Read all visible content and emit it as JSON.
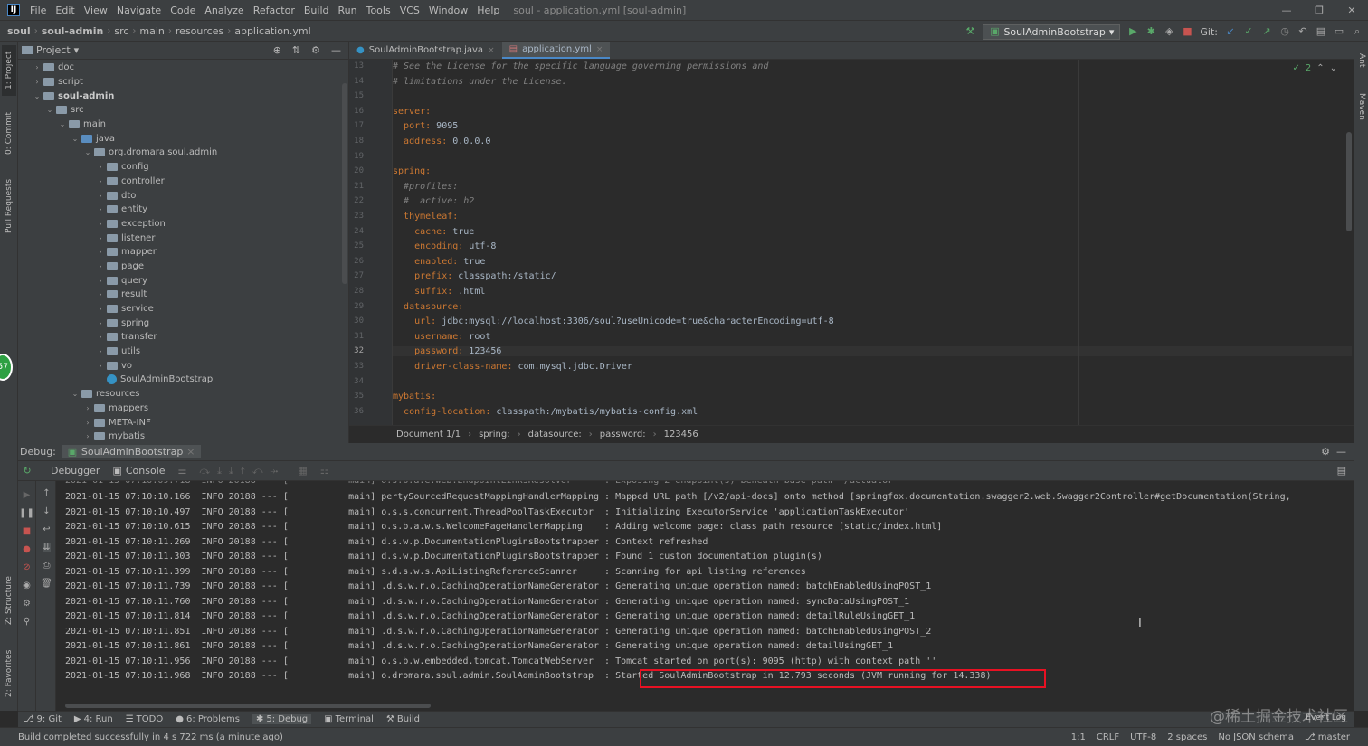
{
  "app": {
    "logo": "IJ",
    "menu": [
      "File",
      "Edit",
      "View",
      "Navigate",
      "Code",
      "Analyze",
      "Refactor",
      "Build",
      "Run",
      "Tools",
      "VCS",
      "Window",
      "Help"
    ],
    "title": "soul - application.yml [soul-admin]"
  },
  "navbar": {
    "crumbs": [
      "soul",
      "soul-admin",
      "src",
      "main",
      "resources",
      "application.yml"
    ],
    "run_config": "SoulAdminBootstrap",
    "git_label": "Git:"
  },
  "left_stripe": {
    "project": "1: Project",
    "commit": "0: Commit",
    "pull": "Pull Requests",
    "structure": "Z: Structure",
    "favorites": "2: Favorites"
  },
  "right_stripe": {
    "ant": "Ant",
    "maven": "Maven"
  },
  "project_panel": {
    "title": "Project",
    "tree": [
      {
        "label": "doc",
        "depth": 1,
        "kind": "folder",
        "open": false
      },
      {
        "label": "script",
        "depth": 1,
        "kind": "folder",
        "open": false
      },
      {
        "label": "soul-admin",
        "depth": 1,
        "kind": "folder",
        "open": true,
        "bold": true
      },
      {
        "label": "src",
        "depth": 2,
        "kind": "folder",
        "open": true
      },
      {
        "label": "main",
        "depth": 3,
        "kind": "folder",
        "open": true
      },
      {
        "label": "java",
        "depth": 4,
        "kind": "folder-blue",
        "open": true
      },
      {
        "label": "org.dromara.soul.admin",
        "depth": 5,
        "kind": "folder",
        "open": true
      },
      {
        "label": "config",
        "depth": 6,
        "kind": "folder",
        "open": false
      },
      {
        "label": "controller",
        "depth": 6,
        "kind": "folder",
        "open": false
      },
      {
        "label": "dto",
        "depth": 6,
        "kind": "folder",
        "open": false
      },
      {
        "label": "entity",
        "depth": 6,
        "kind": "folder",
        "open": false
      },
      {
        "label": "exception",
        "depth": 6,
        "kind": "folder",
        "open": false
      },
      {
        "label": "listener",
        "depth": 6,
        "kind": "folder",
        "open": false
      },
      {
        "label": "mapper",
        "depth": 6,
        "kind": "folder",
        "open": false
      },
      {
        "label": "page",
        "depth": 6,
        "kind": "folder",
        "open": false
      },
      {
        "label": "query",
        "depth": 6,
        "kind": "folder",
        "open": false
      },
      {
        "label": "result",
        "depth": 6,
        "kind": "folder",
        "open": false
      },
      {
        "label": "service",
        "depth": 6,
        "kind": "folder",
        "open": false
      },
      {
        "label": "spring",
        "depth": 6,
        "kind": "folder",
        "open": false
      },
      {
        "label": "transfer",
        "depth": 6,
        "kind": "folder",
        "open": false
      },
      {
        "label": "utils",
        "depth": 6,
        "kind": "folder",
        "open": false
      },
      {
        "label": "vo",
        "depth": 6,
        "kind": "folder",
        "open": false
      },
      {
        "label": "SoulAdminBootstrap",
        "depth": 6,
        "kind": "class",
        "leaf": true
      },
      {
        "label": "resources",
        "depth": 4,
        "kind": "folder",
        "open": true
      },
      {
        "label": "mappers",
        "depth": 5,
        "kind": "folder",
        "open": false
      },
      {
        "label": "META-INF",
        "depth": 5,
        "kind": "folder",
        "open": false
      },
      {
        "label": "mybatis",
        "depth": 5,
        "kind": "folder",
        "open": false
      }
    ]
  },
  "editor": {
    "tabs": [
      {
        "label": "SoulAdminBootstrap.java",
        "active": false
      },
      {
        "label": "application.yml",
        "active": true
      }
    ],
    "inspection_count": "2",
    "lines": [
      {
        "n": "13",
        "t": "# See the License for the specific language governing permissions and",
        "kind": "comment"
      },
      {
        "n": "14",
        "t": "# limitations under the License.",
        "kind": "comment"
      },
      {
        "n": "15",
        "t": "",
        "kind": "plain"
      },
      {
        "n": "16",
        "k": "server:",
        "v": "",
        "indent": 0
      },
      {
        "n": "17",
        "k": "port:",
        "v": " 9095",
        "indent": 1
      },
      {
        "n": "18",
        "k": "address:",
        "v": " 0.0.0.0",
        "indent": 1
      },
      {
        "n": "19",
        "t": "",
        "kind": "plain"
      },
      {
        "n": "20",
        "k": "spring:",
        "v": "",
        "indent": 0
      },
      {
        "n": "21",
        "t": "  #profiles:",
        "kind": "comment"
      },
      {
        "n": "22",
        "t": "  #  active: h2",
        "kind": "comment"
      },
      {
        "n": "23",
        "k": "thymeleaf:",
        "v": "",
        "indent": 1
      },
      {
        "n": "24",
        "k": "cache:",
        "v": " true",
        "indent": 2
      },
      {
        "n": "25",
        "k": "encoding:",
        "v": " utf-8",
        "indent": 2
      },
      {
        "n": "26",
        "k": "enabled:",
        "v": " true",
        "indent": 2
      },
      {
        "n": "27",
        "k": "prefix:",
        "v": " classpath:/static/",
        "indent": 2
      },
      {
        "n": "28",
        "k": "suffix:",
        "v": " .html",
        "indent": 2
      },
      {
        "n": "29",
        "k": "datasource:",
        "v": "",
        "indent": 1
      },
      {
        "n": "30",
        "k": "url:",
        "v": " jdbc:mysql://localhost:3306/soul?useUnicode=true&characterEncoding=utf-8",
        "indent": 2
      },
      {
        "n": "31",
        "k": "username:",
        "v": " root",
        "indent": 2
      },
      {
        "n": "32",
        "k": "password:",
        "v": " 123456",
        "indent": 2,
        "current": true
      },
      {
        "n": "33",
        "k": "driver-class-name:",
        "v": " com.mysql.jdbc.Driver",
        "indent": 2
      },
      {
        "n": "34",
        "t": "",
        "kind": "plain"
      },
      {
        "n": "35",
        "k": "mybatis:",
        "v": "",
        "indent": 0
      },
      {
        "n": "36",
        "k": "config-location:",
        "v": " classpath:/mybatis/mybatis-config.xml",
        "indent": 1
      }
    ],
    "breadcrumb": [
      "Document 1/1",
      "spring:",
      "datasource:",
      "password:",
      "123456"
    ]
  },
  "debug": {
    "label": "Debug:",
    "session": "SoulAdminBootstrap",
    "tabs": [
      "Debugger",
      "Console"
    ],
    "log": [
      "2021-01-15 07:10:10.166  INFO 20188 --- [           main] pertySourcedRequestMappingHandlerMapping : Mapped URL path [/v2/api-docs] onto method [springfox.documentation.swagger2.web.Swagger2Controller#getDocumentation(String,",
      "2021-01-15 07:10:10.497  INFO 20188 --- [           main] o.s.s.concurrent.ThreadPoolTaskExecutor  : Initializing ExecutorService 'applicationTaskExecutor'",
      "2021-01-15 07:10:10.615  INFO 20188 --- [           main] o.s.b.a.w.s.WelcomePageHandlerMapping    : Adding welcome page: class path resource [static/index.html]",
      "2021-01-15 07:10:11.269  INFO 20188 --- [           main] d.s.w.p.DocumentationPluginsBootstrapper : Context refreshed",
      "2021-01-15 07:10:11.303  INFO 20188 --- [           main] d.s.w.p.DocumentationPluginsBootstrapper : Found 1 custom documentation plugin(s)",
      "2021-01-15 07:10:11.399  INFO 20188 --- [           main] s.d.s.w.s.ApiListingReferenceScanner     : Scanning for api listing references",
      "2021-01-15 07:10:11.739  INFO 20188 --- [           main] .d.s.w.r.o.CachingOperationNameGenerator : Generating unique operation named: batchEnabledUsingPOST_1",
      "2021-01-15 07:10:11.760  INFO 20188 --- [           main] .d.s.w.r.o.CachingOperationNameGenerator : Generating unique operation named: syncDataUsingPOST_1",
      "2021-01-15 07:10:11.814  INFO 20188 --- [           main] .d.s.w.r.o.CachingOperationNameGenerator : Generating unique operation named: detailRuleUsingGET_1",
      "2021-01-15 07:10:11.851  INFO 20188 --- [           main] .d.s.w.r.o.CachingOperationNameGenerator : Generating unique operation named: batchEnabledUsingPOST_2",
      "2021-01-15 07:10:11.861  INFO 20188 --- [           main] .d.s.w.r.o.CachingOperationNameGenerator : Generating unique operation named: detailUsingGET_1",
      "2021-01-15 07:10:11.956  INFO 20188 --- [           main] o.s.b.w.embedded.tomcat.TomcatWebServer  : Tomcat started on port(s): 9095 (http) with context path ''",
      "2021-01-15 07:10:11.968  INFO 20188 --- [           main] o.dromara.soul.admin.SoulAdminBootstrap  : Started SoulAdminBootstrap in 12.793 seconds (JVM running for 14.338)"
    ]
  },
  "bottom_tabs": [
    {
      "label": "9: Git",
      "active": false
    },
    {
      "label": "4: Run",
      "active": false
    },
    {
      "label": "TODO",
      "active": false
    },
    {
      "label": "6: Problems",
      "active": false
    },
    {
      "label": "5: Debug",
      "active": true
    },
    {
      "label": "Terminal",
      "active": false
    },
    {
      "label": "Build",
      "active": false
    }
  ],
  "status": {
    "message": "Build completed successfully in 4 s 722 ms (a minute ago)",
    "position": "1:1",
    "line_sep": "CRLF",
    "encoding": "UTF-8",
    "indent": "2 spaces",
    "schema": "No JSON schema",
    "branch": "master"
  },
  "event_log": "Event Log",
  "badge": "57",
  "watermark": "@稀土掘金技术社区",
  "colors": {
    "accent": "#4a88c7",
    "highlight": "#e81123",
    "key": "#cc7832",
    "comment": "#808080"
  }
}
